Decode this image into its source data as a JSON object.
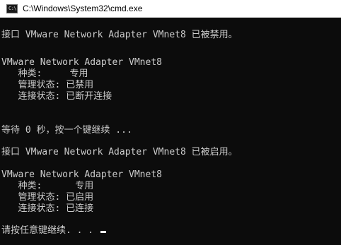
{
  "window": {
    "icon_text": "C:\\",
    "title": "C:\\Windows\\System32\\cmd.exe"
  },
  "console": {
    "lines": [
      "接口 VMware Network Adapter VMnet8 已被禁用。",
      "VMware Network Adapter VMnet8",
      "   种类:     专用",
      "   管理状态: 已禁用",
      "   连接状态: 已断开连接",
      "等待 0 秒，按一个键继续 ...",
      "接口 VMware Network Adapter VMnet8 已被启用。",
      "VMware Network Adapter VMnet8",
      "   种类:      专用",
      "   管理状态: 已启用",
      "   连接状态: 已连接",
      "请按任意键继续. . . "
    ]
  }
}
